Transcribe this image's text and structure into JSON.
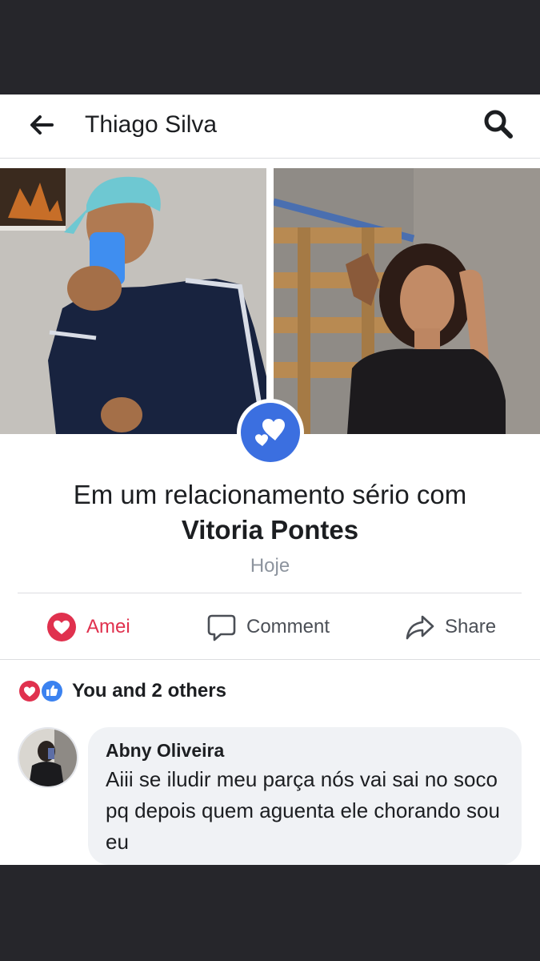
{
  "header": {
    "title": "Thiago Silva",
    "back_icon": "arrow-left-icon",
    "search_icon": "search-icon"
  },
  "life_event": {
    "icon": "hearts-icon",
    "line1": "Em um relacionamento sério com",
    "partner_name": "Vitoria Pontes",
    "date": "Hoje"
  },
  "actions": {
    "react_label": "Amei",
    "comment_label": "Comment",
    "share_label": "Share"
  },
  "reactions": {
    "summary": "You and 2 others",
    "icons": [
      "love-icon",
      "like-icon"
    ]
  },
  "comment": {
    "author": "Abny Oliveira",
    "text": "Aiii se iludir meu parça nós vai sai no soco pq depois quem aguenta ele chorando sou eu"
  },
  "colors": {
    "accent_blue": "#3b6fe0",
    "love_red": "#e0314e",
    "text_dark": "#1c1e21",
    "text_muted": "#8d949e",
    "bubble_bg": "#f0f2f5",
    "frame_dark": "#26262b"
  }
}
